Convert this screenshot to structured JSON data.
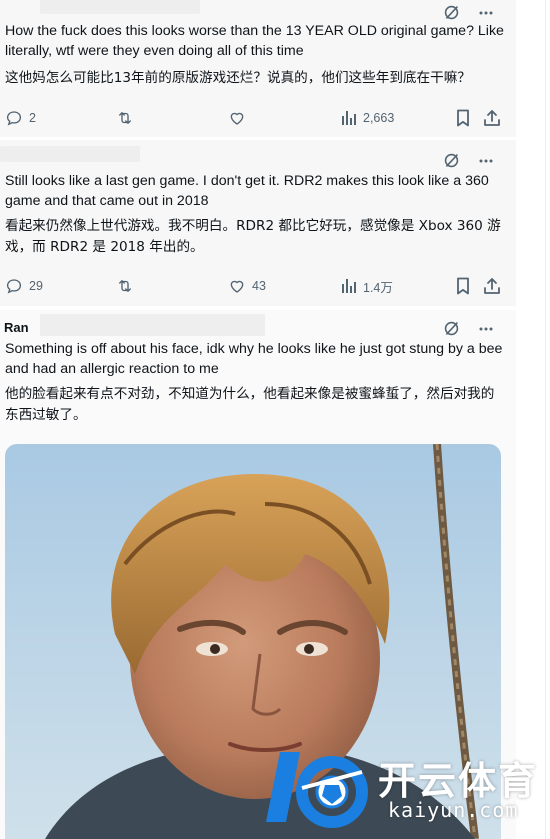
{
  "tweets": [
    {
      "text_en": "How the fuck does this looks worse than the 13 YEAR OLD original game? Like literally, wtf were they even doing all of this time",
      "text_cn": "这他妈怎么可能比13年前的原版游戏还烂？说真的，他们这些年到底在干嘛？",
      "replies": "2",
      "retweets": "",
      "likes": "",
      "views": "2,663"
    },
    {
      "text_en": "Still looks like a last gen game. I don't get it. RDR2 makes this look like a 360 game and that came out in 2018",
      "text_cn": "看起来仍然像上世代游戏。我不明白。RDR2 都比它好玩，感觉像是 Xbox 360 游戏，而 RDR2 是 2018 年出的。",
      "replies": "29",
      "retweets": "",
      "likes": "43",
      "views": "1.4万"
    },
    {
      "author_partial": "Ran",
      "text_en": "Something is off about his face, idk why he looks like he just got stung by a bee and had an allergic reaction to me",
      "text_cn": "他的脸看起来有点不对劲，不知道为什么，他看起来像是被蜜蜂蜇了，然后对我的东西过敏了。"
    }
  ],
  "watermark": {
    "brand_cn": "开云体育",
    "brand_url": "kaiyun.com"
  },
  "colors": {
    "icon_gray": "#536471",
    "text": "#0f1419",
    "watermark_blue": "#1a7fe0"
  },
  "icons": [
    "grok-icon",
    "more-icon",
    "reply-icon",
    "retweet-icon",
    "like-icon",
    "views-icon",
    "bookmark-icon",
    "share-icon"
  ]
}
